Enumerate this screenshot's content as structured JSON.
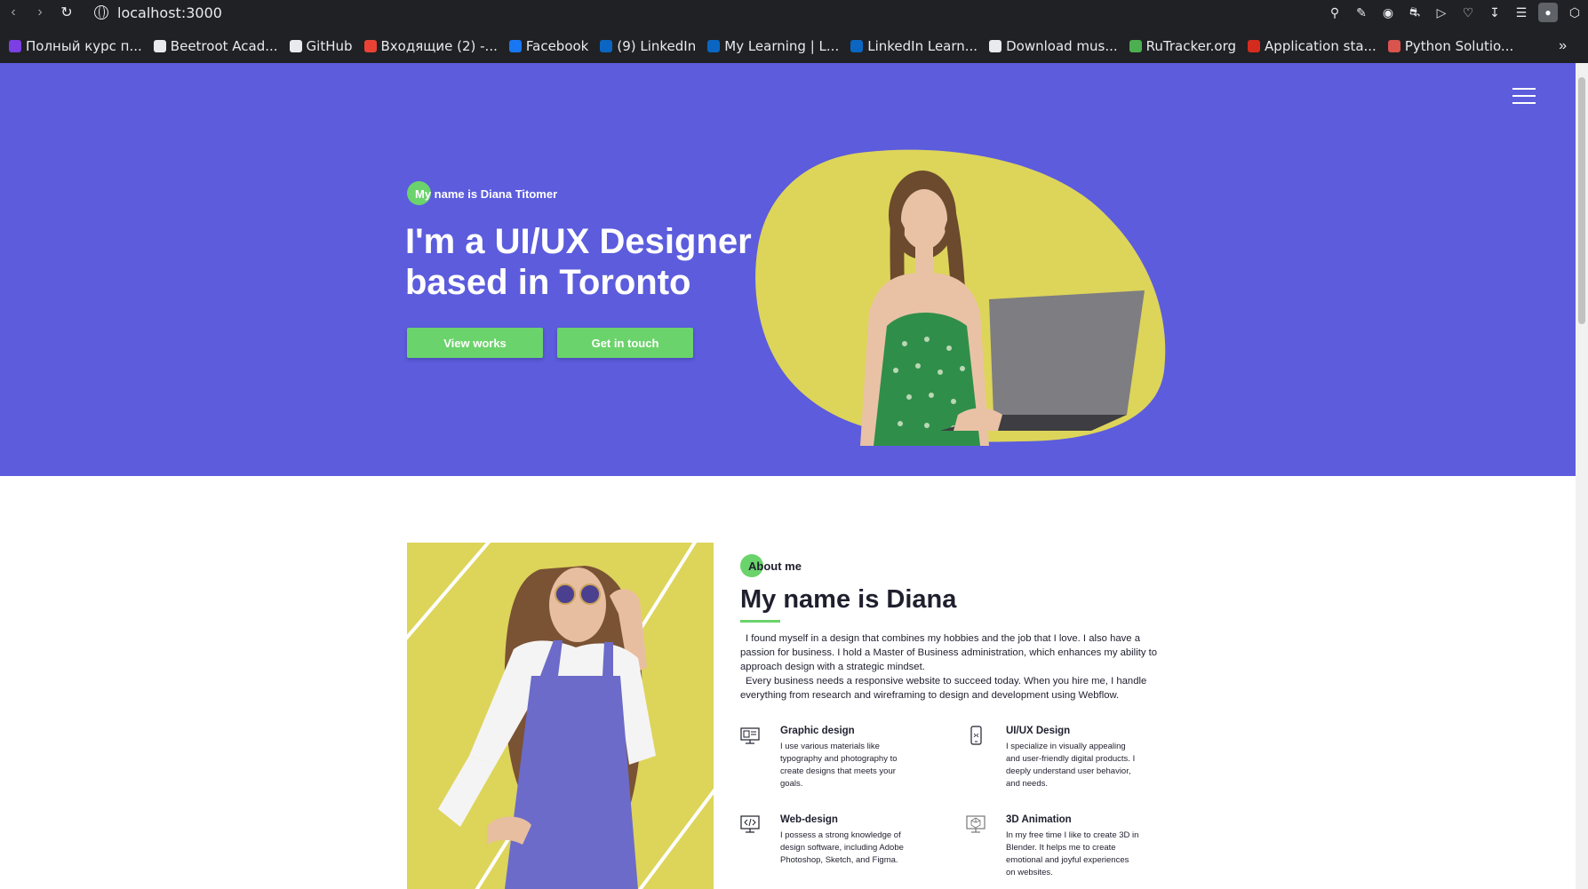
{
  "browser": {
    "url": "localhost:3000",
    "bookmarks": [
      {
        "label": "Полный курс п...",
        "color": "#7b3fe4"
      },
      {
        "label": "Beetroot Acad...",
        "color": "#e8eaed"
      },
      {
        "label": "GitHub",
        "color": "#e8eaed"
      },
      {
        "label": "Входящие (2) -...",
        "color": "#ea4335"
      },
      {
        "label": "Facebook",
        "color": "#1877f2"
      },
      {
        "label": "(9) LinkedIn",
        "color": "#0a66c2"
      },
      {
        "label": "My Learning | L...",
        "color": "#0a66c2"
      },
      {
        "label": "LinkedIn Learn...",
        "color": "#0a66c2"
      },
      {
        "label": "Download mus...",
        "color": "#e8eaed"
      },
      {
        "label": "RuTracker.org",
        "color": "#4caf50"
      },
      {
        "label": "Application sta...",
        "color": "#d52b1e"
      },
      {
        "label": "Python Solutio...",
        "color": "#d9534f"
      }
    ],
    "more_icon": "»"
  },
  "colors": {
    "hero_bg": "#5c5cdd",
    "accent_green": "#6bd36b",
    "blob_yellow": "#ddd45a"
  },
  "hero": {
    "kicker": "My name is Diana Titomer",
    "title": "I'm a UI/UX Designer based in Toronto",
    "btn_view": "View works",
    "btn_touch": "Get in touch"
  },
  "about": {
    "kicker": "About me",
    "title": "My name is Diana",
    "paragraph1": "I found myself in a design that combines my hobbies and the job that I love. I also have a passion for business. I hold a Master of Business administration, which enhances my ability to approach design with a strategic mindset.",
    "paragraph2": "Every business needs a responsive website to succeed today. When you hire me, I handle everything from research and wireframing to design and development using Webflow.",
    "services": [
      {
        "title": "Graphic design",
        "text": "I use various materials like typography and photography to create designs that meets your goals.",
        "icon": "graphic-design-icon"
      },
      {
        "title": "UI/UX Design",
        "text": "I specialize in visually appealing and user-friendly digital products. I deeply understand user behavior, and needs.",
        "icon": "mobile-icon"
      },
      {
        "title": "Web-design",
        "text": "I possess a strong knowledge of design software, including Adobe Photoshop, Sketch, and Figma.",
        "icon": "monitor-code-icon"
      },
      {
        "title": "3D Animation",
        "text": "In my free time I like to create 3D in Blender. It helps me to create emotional and joyful experiences on websites.",
        "icon": "3d-monitor-icon"
      }
    ]
  }
}
